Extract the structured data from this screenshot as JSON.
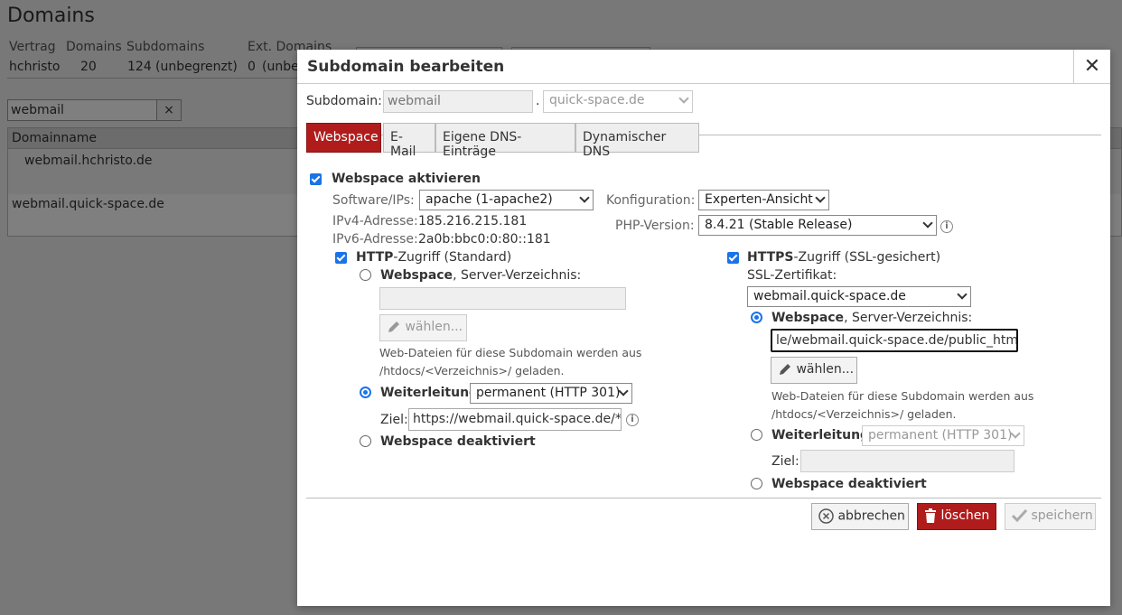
{
  "background": {
    "title": "Domains",
    "headers": [
      "Vertrag",
      "Domains",
      "Subdomains",
      "Ext. Domains"
    ],
    "row": [
      "hchristo",
      "20",
      "124",
      "(unbegrenzt)",
      "0",
      "(unbe"
    ],
    "search_value": "webmail",
    "search_clear": "×",
    "table_header": "Domainname",
    "table_rows": [
      "webmail.hchristo.de",
      "webmail.quick-space.de"
    ]
  },
  "dialog": {
    "title": "Subdomain bearbeiten",
    "close": "✕",
    "subdomain_label": "Subdomain:",
    "subdomain_value": "webmail",
    "dot": ".",
    "domain_value": "quick-space.de",
    "tabs": [
      "Webspace",
      "E-Mail",
      "Eigene DNS-Einträge",
      "Dynamischer DNS"
    ],
    "webspace_activate": "Webspace aktivieren",
    "software_label": "Software/IPs:",
    "software_value": "apache (1-apache2)",
    "ipv4_label": "IPv4-Adresse:",
    "ipv4_value": "185.216.215.181",
    "ipv6_label": "IPv6-Adresse:",
    "ipv6_value": "2a0b:bbc0:0:80::181",
    "konfig_label": "Konfiguration:",
    "konfig_value": "Experten-Ansicht",
    "php_label": "PHP-Version:",
    "php_value": "8.4.21 (Stable Release)",
    "http": {
      "title_bold": "HTTP",
      "title_rest": "-Zugriff (Standard)",
      "webspace_bold": "Webspace",
      "webspace_rest": ", Server-Verzeichnis:",
      "dir_value": "",
      "choose": "wählen...",
      "hint1": "Web-Dateien für diese Subdomain werden aus",
      "hint2": "/htdocs/<Verzeichnis>/ geladen.",
      "redirect": "Weiterleitung",
      "redirect_value": "permanent (HTTP 301)",
      "ziel_label": "Ziel:",
      "ziel_value": "https://webmail.quick-space.de/*",
      "deactivated": "Webspace deaktiviert"
    },
    "https": {
      "title_bold": "HTTPS",
      "title_rest": "-Zugriff (SSL-gesichert)",
      "ssl_label": "SSL-Zertifikat:",
      "ssl_value": "webmail.quick-space.de",
      "webspace_bold": "Webspace",
      "webspace_rest": ", Server-Verzeichnis:",
      "dir_value": "le/webmail.quick-space.de/public_html",
      "choose": "wählen...",
      "hint1": "Web-Dateien für diese Subdomain werden aus",
      "hint2": "/htdocs/<Verzeichnis>/ geladen.",
      "redirect": "Weiterleitung",
      "redirect_value": "permanent (HTTP 301)",
      "ziel_label": "Ziel:",
      "ziel_value": "",
      "deactivated": "Webspace deaktiviert"
    },
    "buttons": {
      "cancel": "abbrechen",
      "delete": "löschen",
      "save": "speichern"
    }
  },
  "colors": {
    "accent": "#b01c1c",
    "checkbox": "#1a73e8"
  }
}
